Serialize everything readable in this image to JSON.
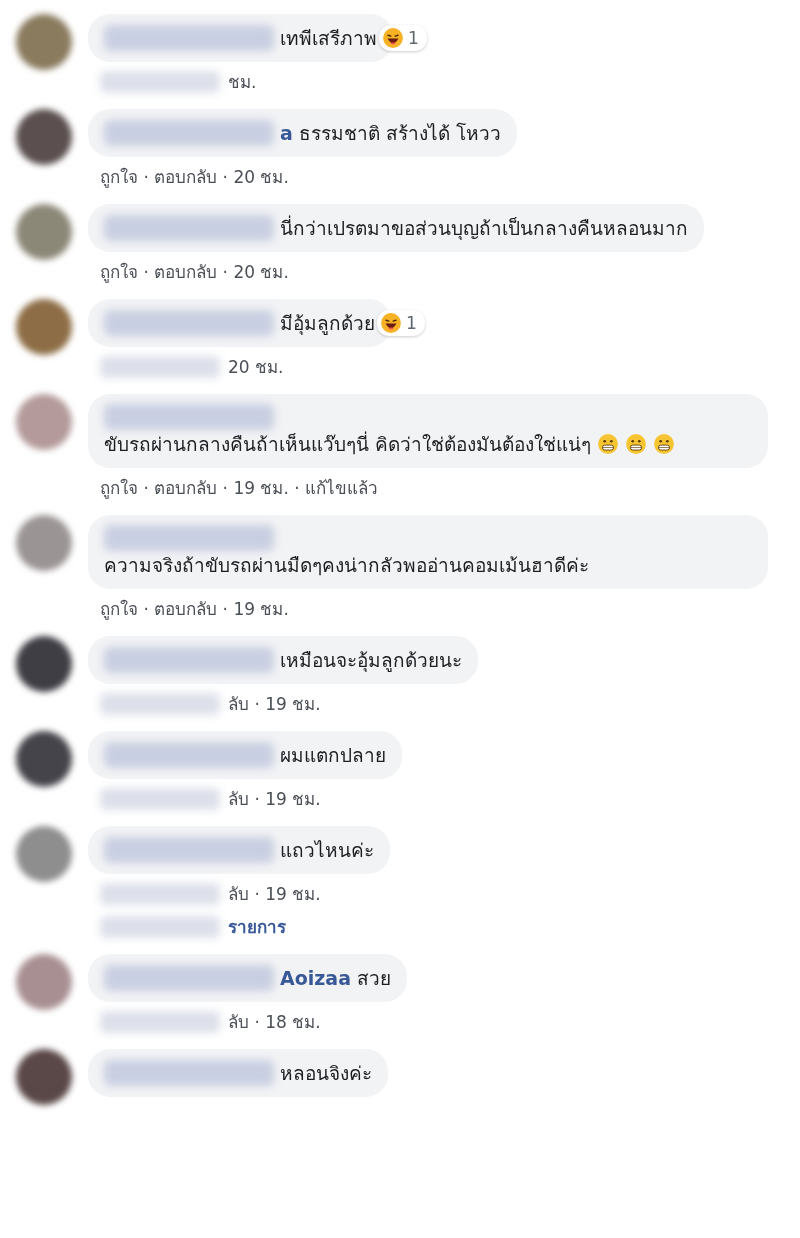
{
  "comments": [
    {
      "redacted": true,
      "text": "เทพีเสรีภาพ",
      "reaction": {
        "kind": "haha",
        "count": "1"
      },
      "meta_redacted": true,
      "meta": "ชม."
    },
    {
      "redacted": true,
      "name_fragment": "a",
      "text": "ธรรมชาติ สร้างได้ โหวว",
      "meta": "ถูกใจ · ตอบกลับ · 20 ชม."
    },
    {
      "redacted": true,
      "text": "นี่กว่าเปรตมาขอส่วนบุญถ้าเป็นกลางคืนหลอนมาก",
      "meta": "ถูกใจ · ตอบกลับ · 20 ชม."
    },
    {
      "redacted": true,
      "text": "มีอุ้มลูกด้วย",
      "reaction": {
        "kind": "haha",
        "count": "1"
      },
      "meta_redacted": true,
      "meta": "20 ชม."
    },
    {
      "redacted": true,
      "text": "ขับรถผ่านกลางคืนถ้าเห็นแว๊บๆนี่ คิดว่าใช่ต้องมันต้องใช่แน่ๆ",
      "inline_emojis": [
        {
          "kind": "grin"
        },
        {
          "kind": "grin"
        },
        {
          "kind": "grin"
        }
      ],
      "meta": "ถูกใจ · ตอบกลับ · 19 ชม. · แก้ไขแล้ว"
    },
    {
      "redacted": true,
      "text": "ความจริงถ้าขับรถผ่านมืดๆคงน่ากลัวพออ่านคอมเม้นฮาดีค่ะ",
      "meta": "ถูกใจ · ตอบกลับ · 19 ชม."
    },
    {
      "redacted": true,
      "text": "เหมือนจะอุ้มลูกด้วยนะ",
      "meta_redacted": true,
      "meta": "ลับ · 19 ชม."
    },
    {
      "redacted": true,
      "text": "ผมแตกปลาย",
      "meta_redacted": true,
      "meta": "ลับ · 19 ชม."
    },
    {
      "redacted": true,
      "text": "แถวไหนค่ะ",
      "meta_redacted": true,
      "meta": "ลับ · 19 ชม.",
      "replies_link": "รายการ"
    },
    {
      "redacted": true,
      "name_fragment": "Aoizaa",
      "text": "สวย",
      "meta_redacted": true,
      "meta": "ลับ · 18 ชม."
    },
    {
      "redacted": true,
      "text": "หลอนจิงค่ะ"
    }
  ]
}
